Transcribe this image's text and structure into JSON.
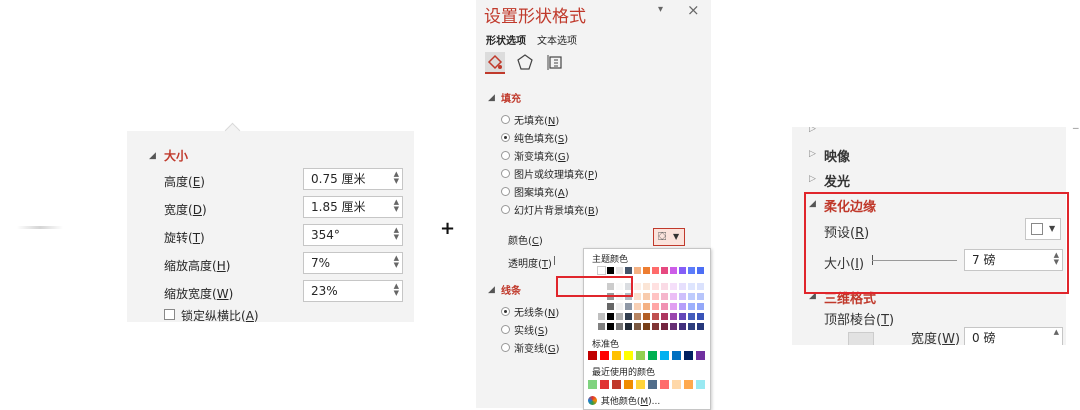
{
  "left": {
    "section": "大小",
    "rows": [
      {
        "label": "高度",
        "key": "E",
        "value": "0.75 厘米"
      },
      {
        "label": "宽度",
        "key": "D",
        "value": "1.85 厘米"
      },
      {
        "label": "旋转",
        "key": "T",
        "value": "354°"
      },
      {
        "label": "缩放高度",
        "key": "H",
        "value": "7%"
      },
      {
        "label": "缩放宽度",
        "key": "W",
        "value": "23%"
      }
    ],
    "lock": {
      "label": "锁定纵横比",
      "key": "A"
    }
  },
  "plus": "+",
  "mid": {
    "title": "设置形状格式",
    "pin": "▾",
    "close": "×",
    "tabs": [
      "形状选项",
      "文本选项"
    ],
    "fill_section": "填充",
    "fill_options": [
      {
        "label": "无填充",
        "key": "N"
      },
      {
        "label": "纯色填充",
        "key": "S",
        "selected": true
      },
      {
        "label": "渐变填充",
        "key": "G"
      },
      {
        "label": "图片或纹理填充",
        "key": "P"
      },
      {
        "label": "图案填充",
        "key": "A"
      },
      {
        "label": "幻灯片背景填充",
        "key": "B"
      }
    ],
    "color_label": "颜色",
    "color_key": "C",
    "transparency_label": "透明度",
    "transparency_key": "T",
    "line_section": "线条",
    "line_options": [
      {
        "label": "无线条",
        "key": "N",
        "selected": true
      },
      {
        "label": "实线",
        "key": "S"
      },
      {
        "label": "渐变线",
        "key": "G"
      }
    ]
  },
  "color_dropdown": {
    "theme_label": "主题颜色",
    "standard_label": "标准色",
    "recent_label": "最近使用的颜色",
    "more_label": "其他颜色",
    "more_key": "M",
    "theme_top": [
      "#ffffff",
      "#000000",
      "#e7e6e6",
      "#44546a",
      "#f4b183",
      "#ed7d31",
      "#ff6b6b",
      "#e64980",
      "#cc5de8",
      "#845ef7",
      "#5c7cfa",
      "#4c6ef5"
    ],
    "standard": [
      "#c00000",
      "#ff0000",
      "#ffc000",
      "#ffff00",
      "#92d050",
      "#00b050",
      "#00b0f0",
      "#0070c0",
      "#002060",
      "#7030a0"
    ],
    "recent": [
      "#7fd37f",
      "#e03131",
      "#c0392b",
      "#f08c00",
      "#ffd43b",
      "#4f6d8a",
      "#ff6b6b",
      "#ffd8a8",
      "#ffa94d",
      "#99e9f2"
    ]
  },
  "right": {
    "items": [
      "映像",
      "发光"
    ],
    "soft_edge": "柔化边缘",
    "preset_label": "预设",
    "preset_key": "R",
    "size_label": "大小",
    "size_key": "I",
    "size_value": "7 磅",
    "threed_label": "三维格式",
    "bevel_label": "顶部棱台",
    "bevel_key": "T",
    "width_label": "宽度",
    "width_key": "W",
    "width_value": "0 磅"
  }
}
